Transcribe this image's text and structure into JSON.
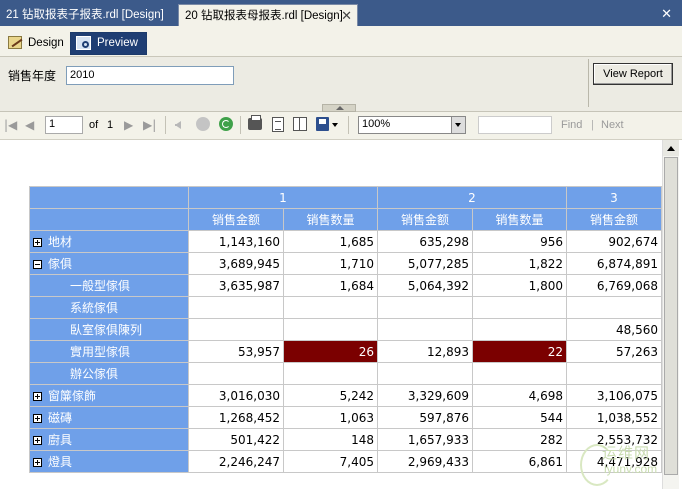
{
  "doc_tabs": {
    "inactive_tab": "21 钻取报表子报表.rdl [Design]",
    "active_tab": "20 钻取报表母报表.rdl [Design]",
    "close_glyph": "✕",
    "window_close_glyph": "✕"
  },
  "view_tabs": {
    "design_label": "Design",
    "preview_label": "Preview"
  },
  "parameters": {
    "label": "销售年度",
    "value": "2010",
    "view_report_label": "View Report"
  },
  "toolbar": {
    "first_glyph": "|◀",
    "prev_glyph": "◀",
    "next_glyph": "▶",
    "last_glyph": "▶|",
    "page_value": "1",
    "of_label": "of",
    "total_pages": "1",
    "zoom_value": "100%",
    "find_label": "Find",
    "divider": "|",
    "next_label": "Next"
  },
  "report": {
    "column_groups": [
      "1",
      "2",
      "3"
    ],
    "measures": [
      "销售金额",
      "销售数量",
      "销售金额",
      "销售数量",
      "销售金额"
    ],
    "rows": [
      {
        "label": "地材",
        "level": 0,
        "toggle": "plus",
        "values": [
          "1,143,160",
          "1,685",
          "635,298",
          "956",
          "902,674"
        ]
      },
      {
        "label": "傢俱",
        "level": 0,
        "toggle": "minus",
        "values": [
          "3,689,945",
          "1,710",
          "5,077,285",
          "1,822",
          "6,874,891"
        ]
      },
      {
        "label": "一般型傢俱",
        "level": 1,
        "toggle": "",
        "values": [
          "3,635,987",
          "1,684",
          "5,064,392",
          "1,800",
          "6,769,068"
        ]
      },
      {
        "label": "系統傢俱",
        "level": 1,
        "toggle": "",
        "values": [
          "",
          "",
          "",
          "",
          ""
        ]
      },
      {
        "label": "臥室傢俱陳列",
        "level": 1,
        "toggle": "",
        "values": [
          "",
          "",
          "",
          "",
          "48,560"
        ]
      },
      {
        "label": "實用型傢俱",
        "level": 1,
        "toggle": "",
        "values": [
          "53,957",
          "26",
          "12,893",
          "22",
          "57,263"
        ],
        "highlight": [
          1,
          3
        ]
      },
      {
        "label": "辦公傢俱",
        "level": 1,
        "toggle": "",
        "values": [
          "",
          "",
          "",
          "",
          ""
        ]
      },
      {
        "label": "窗簾傢飾",
        "level": 0,
        "toggle": "plus",
        "values": [
          "3,016,030",
          "5,242",
          "3,329,609",
          "4,698",
          "3,106,075"
        ]
      },
      {
        "label": "磁磚",
        "level": 0,
        "toggle": "plus",
        "values": [
          "1,268,452",
          "1,063",
          "597,876",
          "544",
          "1,038,552"
        ]
      },
      {
        "label": "廚具",
        "level": 0,
        "toggle": "plus",
        "values": [
          "501,422",
          "148",
          "1,657,933",
          "282",
          "2,553,732"
        ]
      },
      {
        "label": "燈具",
        "level": 0,
        "toggle": "plus",
        "values": [
          "2,246,247",
          "7,405",
          "2,969,433",
          "6,861",
          "4,471,928"
        ]
      }
    ]
  },
  "watermark": {
    "cn": "运维网",
    "en": "iyunv.com"
  }
}
